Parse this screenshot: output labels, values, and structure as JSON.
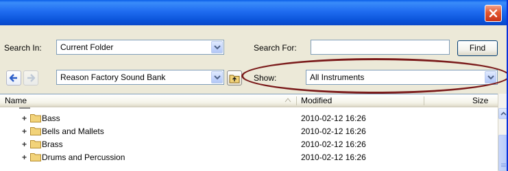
{
  "window": {
    "close_icon": "close-icon"
  },
  "search": {
    "search_in_label": "Search In:",
    "search_in_value": "Current Folder",
    "search_for_label": "Search For:",
    "search_for_value": "",
    "find_label": "Find"
  },
  "browse": {
    "location_value": "Reason Factory Sound Bank",
    "show_label": "Show:",
    "show_value": "All Instruments"
  },
  "list": {
    "columns": {
      "name": "Name",
      "modified": "Modified",
      "size": "Size"
    },
    "rows": [
      {
        "name": "Bass",
        "modified": "2010-02-12 16:26"
      },
      {
        "name": "Bells and Mallets",
        "modified": "2010-02-12 16:26"
      },
      {
        "name": "Brass",
        "modified": "2010-02-12 16:26"
      },
      {
        "name": "Drums and Percussion",
        "modified": "2010-02-12 16:26"
      }
    ]
  },
  "colors": {
    "title_bar": "#1F6CF0",
    "window_face": "#ECE9D8",
    "annotation_ellipse": "#7A1A1A",
    "folder_yellow": "#F2D37A"
  }
}
